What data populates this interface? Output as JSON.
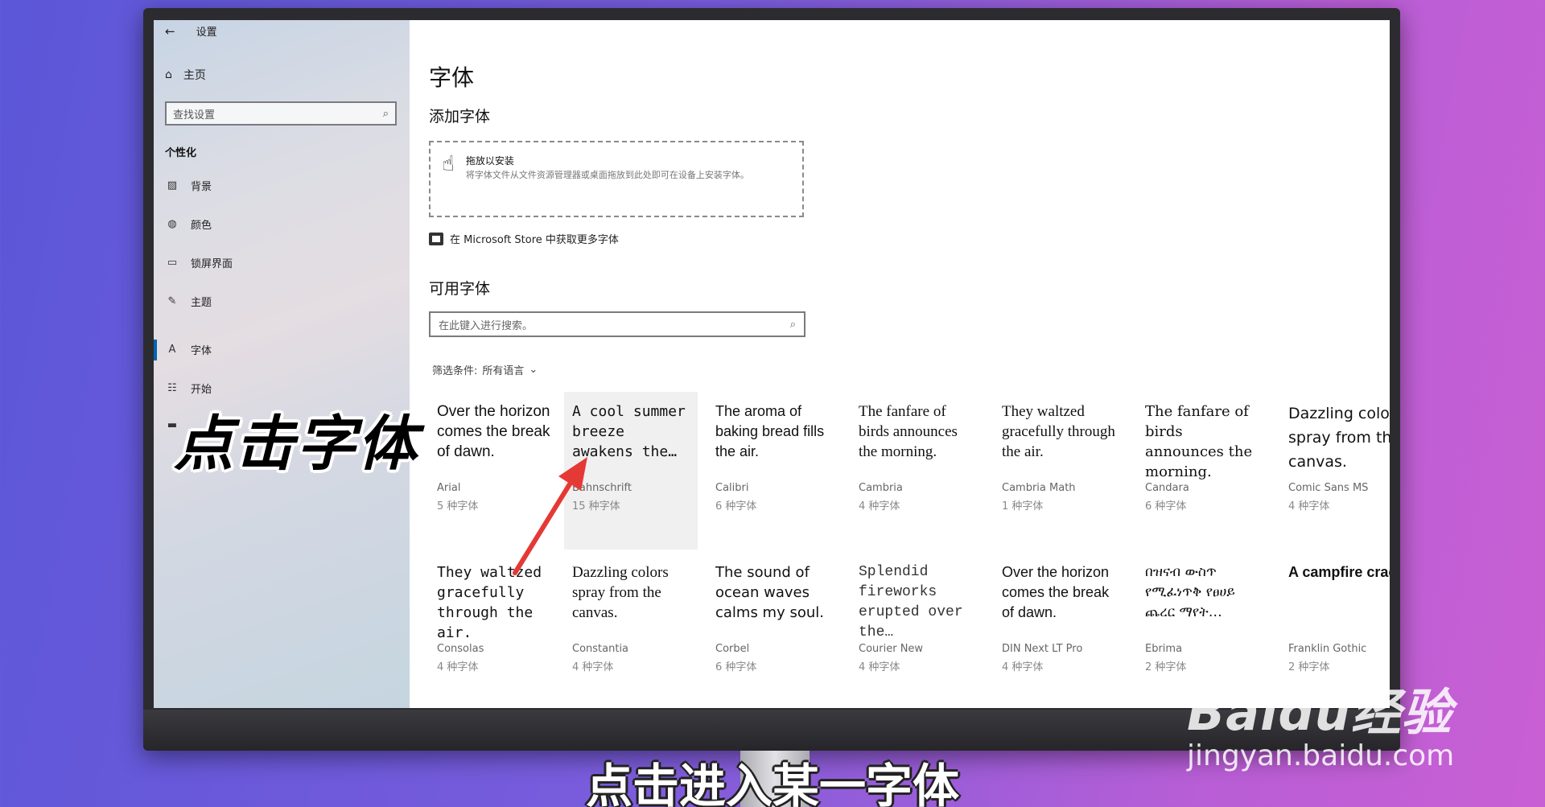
{
  "window": {
    "title": "设置"
  },
  "sidebar": {
    "home": "主页",
    "search_placeholder": "查找设置",
    "section": "个性化",
    "items": [
      {
        "label": "背景",
        "icon": "image-icon"
      },
      {
        "label": "颜色",
        "icon": "palette-icon"
      },
      {
        "label": "锁屏界面",
        "icon": "lock-screen-icon"
      },
      {
        "label": "主题",
        "icon": "theme-icon"
      },
      {
        "label": "字体",
        "icon": "font-icon"
      },
      {
        "label": "开始",
        "icon": "start-icon"
      }
    ]
  },
  "main": {
    "title": "字体",
    "add_heading": "添加字体",
    "drop_title": "拖放以安装",
    "drop_desc": "将字体文件从文件资源管理器或桌面拖放到此处即可在设备上安装字体。",
    "store_link": "在 Microsoft Store 中获取更多字体",
    "available_heading": "可用字体",
    "search_placeholder": "在此键入进行搜索。",
    "filter_label": "筛选条件:",
    "filter_value": "所有语言"
  },
  "fonts": [
    {
      "sample": "Over the horizon comes the break of dawn.",
      "name": "Arial",
      "count": "5 种字体"
    },
    {
      "sample": "A cool summer breeze awakens the…",
      "name": "Bahnschrift",
      "count": "15 种字体"
    },
    {
      "sample": "The aroma of baking bread fills the air.",
      "name": "Calibri",
      "count": "6 种字体"
    },
    {
      "sample": "The fanfare of birds announces the morning.",
      "name": "Cambria",
      "count": "4 种字体"
    },
    {
      "sample": "They waltzed gracefully through the air.",
      "name": "Cambria Math",
      "count": "1 种字体"
    },
    {
      "sample": "The fanfare of birds announces the morning.",
      "name": "Candara",
      "count": "6 种字体"
    },
    {
      "sample": "Dazzling colors spray from the canvas.",
      "name": "Comic Sans MS",
      "count": "4 种字体"
    },
    {
      "sample": "They waltzed gracefully through the air.",
      "name": "Consolas",
      "count": "4 种字体"
    },
    {
      "sample": "Dazzling colors spray from the canvas.",
      "name": "Constantia",
      "count": "4 种字体"
    },
    {
      "sample": "The sound of ocean waves calms my soul.",
      "name": "Corbel",
      "count": "6 种字体"
    },
    {
      "sample": "Splendid fireworks erupted over the…",
      "name": "Courier New",
      "count": "4 种字体"
    },
    {
      "sample": "Over the horizon comes the break of dawn.",
      "name": "DIN Next LT Pro",
      "count": "4 种字体"
    },
    {
      "sample": "በዝናብ ውስጥ የሚፈነጥቅ የፀሀይ ጨረር ማየት…",
      "name": "Ebrima",
      "count": "2 种字体"
    },
    {
      "sample": "A campfire crackles as the children gath…",
      "name": "Franklin Gothic",
      "count": "2 种字体"
    }
  ],
  "overlay": {
    "annotation": "点击字体",
    "caption": "点击进入某一字体",
    "watermark_logo": "Baidu经验",
    "watermark_url": "jingyan.baidu.com",
    "arrow_color": "#e53935"
  }
}
